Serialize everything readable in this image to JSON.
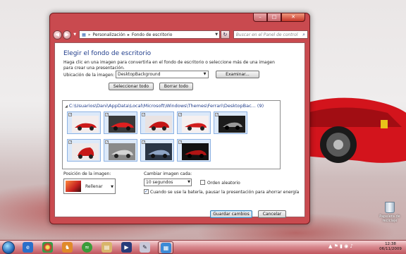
{
  "window": {
    "controls": {
      "minimize": "–",
      "maximize": "□",
      "close": "✕"
    },
    "breadcrumb": [
      "Personalización",
      "Fondo de escritorio"
    ],
    "search_placeholder": "Buscar en el Panel de control",
    "refresh_glyph": "↻",
    "search_glyph": "⌕"
  },
  "content": {
    "title": "Elegir el fondo de escritorio",
    "description": "Haga clic en una imagen para convertirla en el fondo de escritorio o seleccione más de una imagen para crear una presentación.",
    "location_label": "Ubicación de la imagen:",
    "location_value": "DesktopBackground",
    "browse_button": "Examinar...",
    "select_all_button": "Seleccionar todo",
    "clear_all_button": "Borrar todo",
    "folder_path": "C:\\Usuarios\\Dani\\AppData\\Local\\Microsoft\\Windows\\Themes\\Ferrari\\DesktopBac... (9)",
    "thumbnails": [
      {
        "checked": true,
        "theme": "red"
      },
      {
        "checked": true,
        "theme": "red"
      },
      {
        "checked": true,
        "theme": "red"
      },
      {
        "checked": true,
        "theme": "red"
      },
      {
        "checked": true,
        "theme": "dark"
      },
      {
        "checked": true,
        "theme": "red"
      },
      {
        "checked": true,
        "theme": "silver"
      },
      {
        "checked": true,
        "theme": "blue"
      },
      {
        "checked": true,
        "theme": "dark"
      }
    ],
    "position_label": "Posición de la imagen:",
    "position_value": "Rellenar",
    "change_label": "Cambiar imagen cada:",
    "change_value": "10 segundos",
    "shuffle_label": "Orden aleatorio",
    "shuffle_checked": false,
    "battery_label": "Cuando se use la batería, pausar la presentación para ahorrar energía",
    "battery_checked": true,
    "save_button": "Guardar cambios",
    "cancel_button": "Cancelar"
  },
  "desktop": {
    "recycle_bin_label": "Papelera de reciclaje"
  },
  "taskbar": {
    "icons": [
      "ie-icon",
      "chrome-icon",
      "firefox-icon",
      "games-icon",
      "spotify-icon",
      "explorer-icon",
      "media-icon",
      "mail-icon",
      "messenger-icon",
      "control-panel-icon"
    ],
    "tray": "▲ ⚑ ▮ ◉ ♪",
    "time": "12:38",
    "date": "06/11/2009"
  },
  "colors": {
    "accent": "#c94a4f",
    "heading": "#1e3b8a",
    "selection": "#dce9f9"
  }
}
